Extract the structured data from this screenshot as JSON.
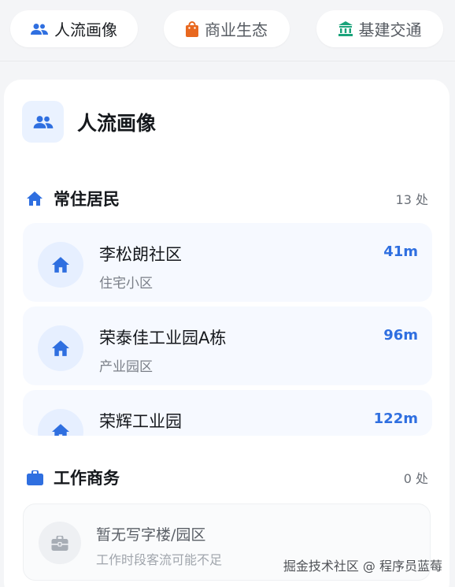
{
  "tabs": [
    {
      "label": "人流画像",
      "icon": "people-icon",
      "color": "#2f6fe0",
      "active": true
    },
    {
      "label": "商业生态",
      "icon": "shopping-bag-icon",
      "color": "#e8681f",
      "active": false
    },
    {
      "label": "基建交通",
      "icon": "bank-icon",
      "color": "#1aa37a",
      "active": false
    }
  ],
  "card": {
    "title": "人流画像",
    "icon": "people-icon"
  },
  "residents": {
    "title": "常住居民",
    "count": "13 处",
    "icon": "home-icon",
    "items": [
      {
        "name": "李松朗社区",
        "type": "住宅小区",
        "distance": "41m"
      },
      {
        "name": "荣泰佳工业园A栋",
        "type": "产业园区",
        "distance": "96m"
      },
      {
        "name": "荣辉工业园",
        "type": "",
        "distance": "122m"
      }
    ]
  },
  "business": {
    "title": "工作商务",
    "count": "0 处",
    "icon": "briefcase-icon",
    "empty_title": "暂无写字楼/园区",
    "empty_sub": "工作时段客流可能不足"
  },
  "watermark": "掘金技术社区 @ 程序员蓝莓",
  "colors": {
    "accent": "#2f6fe0",
    "accent_bg": "#eaf2ff"
  }
}
